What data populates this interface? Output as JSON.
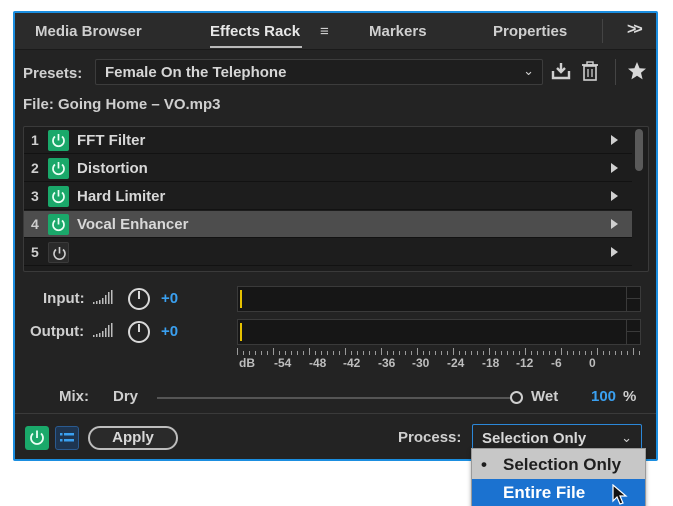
{
  "tabs": {
    "items": [
      {
        "label": "Media Browser"
      },
      {
        "label": "Effects Rack",
        "active": true
      },
      {
        "label": "Markers"
      },
      {
        "label": "Properties"
      }
    ],
    "menu_glyph": "≡",
    "overflow_glyph": ">>"
  },
  "presets": {
    "label": "Presets:",
    "value": "Female On the Telephone",
    "icons": [
      "chevron-down-icon",
      "download-icon",
      "trash-icon",
      "star-icon"
    ]
  },
  "file": {
    "label": "File: Going Home – VO.mp3"
  },
  "rack": {
    "rows": [
      {
        "num": "1",
        "name": "FFT Filter",
        "on": true,
        "selected": false
      },
      {
        "num": "2",
        "name": "Distortion",
        "on": true,
        "selected": false
      },
      {
        "num": "3",
        "name": "Hard Limiter",
        "on": true,
        "selected": false
      },
      {
        "num": "4",
        "name": "Vocal Enhancer",
        "on": true,
        "selected": true
      },
      {
        "num": "5",
        "name": "",
        "on": false,
        "selected": false
      }
    ]
  },
  "io": {
    "input_label": "Input:",
    "input_value": "+0",
    "output_label": "Output:",
    "output_value": "+0"
  },
  "meter_scale": [
    "dB",
    "-54",
    "-48",
    "-42",
    "-36",
    "-30",
    "-24",
    "-18",
    "-12",
    "-6",
    "0"
  ],
  "mix": {
    "label": "Mix:",
    "dry": "Dry",
    "wet": "Wet",
    "value": "100",
    "unit": "%",
    "level_percent": 100
  },
  "footer": {
    "apply_label": "Apply",
    "process_label": "Process:",
    "process_value": "Selection Only"
  },
  "dropdown": {
    "options": [
      {
        "label": "Selection Only",
        "checked": true
      },
      {
        "label": "Entire File",
        "highlighted": true
      }
    ]
  },
  "colors": {
    "accent_green": "#1aa86a",
    "accent_blue": "#3aa0f0",
    "focus_border": "#1b8ee0",
    "meter_yellow": "#e6c100",
    "highlight": "#1b72d0"
  }
}
